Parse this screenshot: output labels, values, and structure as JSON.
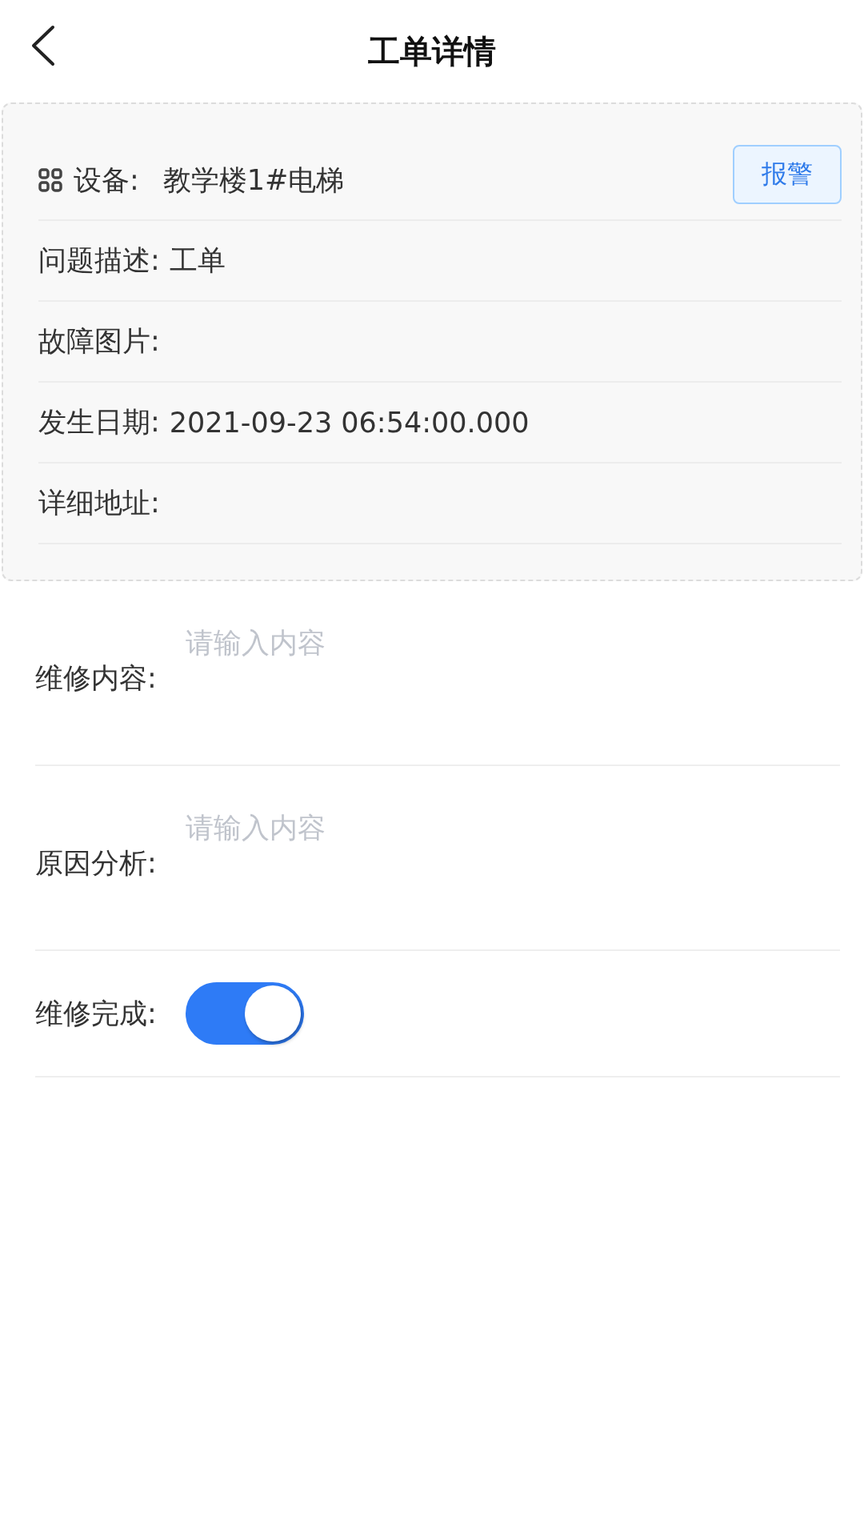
{
  "header": {
    "title": "工单详情"
  },
  "details": {
    "device": {
      "label": "设备:",
      "value": "教学楼1#电梯"
    },
    "alarm_button": "报警",
    "rows": [
      {
        "label": "问题描述:",
        "value": "工单"
      },
      {
        "label": "故障图片:"
      },
      {
        "label": "发生日期:",
        "value": "2021-09-23 06:54:00.000"
      },
      {
        "label": "详细地址:"
      }
    ]
  },
  "form": {
    "fields": [
      {
        "kind": "textarea",
        "label": "维修内容:",
        "placeholder": "请输入内容"
      },
      {
        "kind": "textarea",
        "label": "原因分析:",
        "placeholder": "请输入内容"
      },
      {
        "kind": "switch",
        "label": "维修完成:",
        "on": true
      }
    ]
  }
}
